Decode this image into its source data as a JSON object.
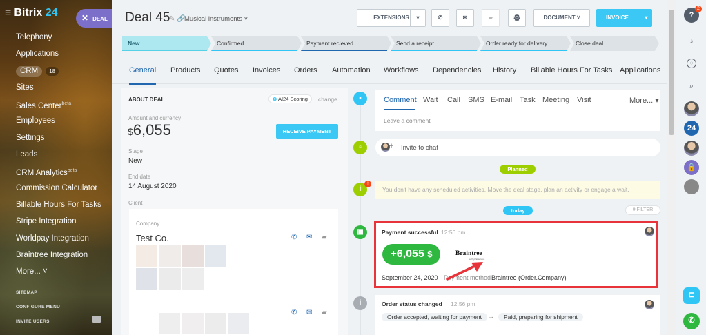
{
  "sidebar": {
    "logo_prefix": "Bitrix",
    "logo_suffix": "24",
    "deal_button": "DEAL",
    "items": [
      {
        "label": "Telephony"
      },
      {
        "label": "Applications"
      },
      {
        "label": "CRM",
        "count": "18"
      },
      {
        "label": "Sites"
      },
      {
        "label": "Sales Center",
        "sup": "beta"
      },
      {
        "label": "Employees"
      },
      {
        "label": "Settings"
      },
      {
        "label": "Leads"
      },
      {
        "label": "CRM Analytics",
        "sup": "beta"
      },
      {
        "label": "Commission Calculator"
      },
      {
        "label": "Billable Hours For Tasks"
      },
      {
        "label": "Stripe Integration"
      },
      {
        "label": "Worldpay Integration"
      },
      {
        "label": "Braintree Integration"
      },
      {
        "label": "More... ˅"
      }
    ],
    "sitemap": "SITEMAP",
    "configure": "CONFIGURE MENU",
    "invite": "INVITE USERS"
  },
  "header": {
    "title": "Deal 45",
    "category": "Musical instruments",
    "extensions": "EXTENSIONS",
    "document": "DOCUMENT",
    "invoice": "INVOICE"
  },
  "stages": [
    {
      "label": "New",
      "color": "#ade7f0"
    },
    {
      "label": "Confirmed"
    },
    {
      "label": "Payment recieved"
    },
    {
      "label": "Send a receipt"
    },
    {
      "label": "Order ready for delivery"
    },
    {
      "label": "Close deal"
    }
  ],
  "tabs": [
    "General",
    "Products",
    "Quotes",
    "Invoices",
    "Orders",
    "Automation",
    "Workflows",
    "Dependencies",
    "History",
    "Billable Hours For Tasks",
    "Applications"
  ],
  "about": {
    "header": "ABOUT DEAL",
    "scoring": "AI24 Scoring",
    "change": "change",
    "amount_label": "Amount and currency",
    "amount_currency": "$",
    "amount_value": "6,055",
    "receive_payment": "RECEIVE PAYMENT",
    "stage_label": "Stage",
    "stage_value": "New",
    "end_label": "End date",
    "end_value": "14 August 2020",
    "client_label": "Client",
    "company_label": "Company",
    "company_value": "Test Co."
  },
  "timeline": {
    "comment_tabs": [
      "Comment",
      "Wait",
      "Call",
      "SMS",
      "E-mail",
      "Task",
      "Meeting",
      "Visit"
    ],
    "more": "More...",
    "leave_comment": "Leave a comment",
    "invite_chat": "Invite to chat",
    "planned": "Planned",
    "no_activities": "You don't have any scheduled activities. Move the deal stage, plan an activity or engage a wait.",
    "today": "today",
    "filter": "FILTER",
    "payment_title": "Payment successful",
    "payment_time": "12:56 pm",
    "payment_amount": "+6,055",
    "payment_currency": "$",
    "provider": "Braintree",
    "provider_sub": "a PayPal service",
    "payment_date": "September 24, 2020",
    "payment_method_label": "Payment method",
    "payment_method_value": "Braintree (Order.Company)",
    "order_title": "Order status changed",
    "order_time": "12:56 pm",
    "order_from": "Order accepted, waiting for payment",
    "order_arrow": "→",
    "order_to": "Paid, preparing for shipment"
  },
  "right_panel": {
    "help_badge": "2",
    "bitrix24": "24"
  },
  "colors": {
    "accent": "#2fc6f6",
    "highlight": "#e8333a",
    "success": "#2fb840",
    "planned": "#9dcf00"
  }
}
